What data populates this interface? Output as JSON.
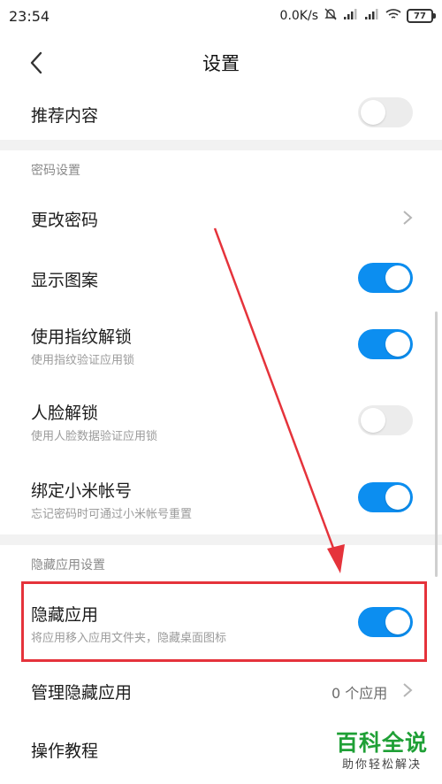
{
  "status_bar": {
    "time": "23:54",
    "speed": "0.0K/s",
    "battery": "77"
  },
  "header": {
    "title": "设置"
  },
  "rows": {
    "recommend": {
      "title": "推荐内容",
      "toggle_on": false
    },
    "password_section_label": "密码设置",
    "change_password": {
      "title": "更改密码"
    },
    "show_pattern": {
      "title": "显示图案",
      "toggle_on": true
    },
    "fingerprint": {
      "title": "使用指纹解锁",
      "subtitle": "使用指纹验证应用锁",
      "toggle_on": true
    },
    "face_unlock": {
      "title": "人脸解锁",
      "subtitle": "使用人脸数据验证应用锁",
      "toggle_on": false
    },
    "bind_mi_account": {
      "title": "绑定小米帐号",
      "subtitle": "忘记密码时可通过小米帐号重置",
      "toggle_on": true
    },
    "hidden_section_label": "隐藏应用设置",
    "hide_apps": {
      "title": "隐藏应用",
      "subtitle": "将应用移入应用文件夹，隐藏桌面图标",
      "toggle_on": true
    },
    "manage_hidden": {
      "title": "管理隐藏应用",
      "value": "0 个应用"
    },
    "tutorial": {
      "title": "操作教程"
    }
  },
  "watermark": {
    "main": "百科全说",
    "sub": "助你轻松解决"
  },
  "colors": {
    "accent": "#0c8ef0",
    "highlight": "#e5333b",
    "watermark_green": "#1fa036"
  }
}
